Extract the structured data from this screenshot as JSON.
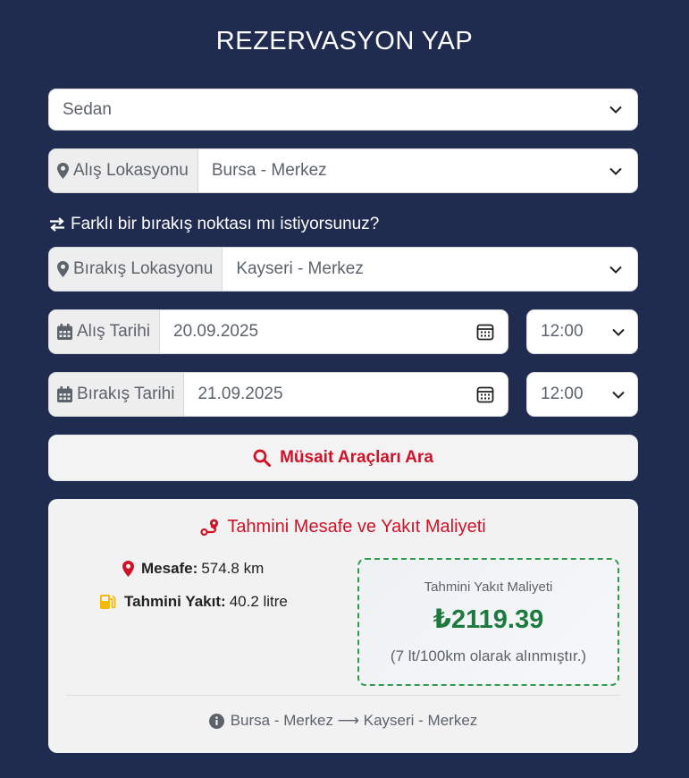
{
  "title": "REZERVASYON YAP",
  "vehicle_select": {
    "value": "Sedan"
  },
  "pickup_location": {
    "label": "Alış Lokasyonu",
    "value": "Bursa - Merkez"
  },
  "dropoff_hint": "Farklı bir bırakış noktası mı istiyorsunuz?",
  "dropoff_location": {
    "label": "Bırakış Lokasyonu",
    "value": "Kayseri - Merkez"
  },
  "pickup_date": {
    "label": "Alış Tarihi",
    "value": "20.09.2025",
    "time": "12:00"
  },
  "dropoff_date": {
    "label": "Bırakış Tarihi",
    "value": "21.09.2025",
    "time": "12:00"
  },
  "search_button": "Müsait Araçları Ara",
  "estimate": {
    "title": "Tahmini Mesafe ve Yakıt Maliyeti",
    "distance_label": "Mesafe:",
    "distance_value": "574.8 km",
    "fuel_label": "Tahmini Yakıt:",
    "fuel_value": "40.2 litre",
    "cost_label": "Tahmini Yakıt Maliyeti",
    "cost_value": "₺2119.39",
    "cost_note": "(7 lt/100km olarak alınmıştır.)",
    "route": "Bursa - Merkez ⟶ Kayseri - Merkez"
  },
  "colors": {
    "background": "#1f2b4f",
    "accent_red": "#d01228",
    "accent_green": "#1d7a3f",
    "fuel_icon": "#f2b90f"
  },
  "icons": [
    "chevron-down-icon",
    "map-pin-icon",
    "swap-arrows-icon",
    "calendar-icon",
    "calendar-picker-icon",
    "search-icon",
    "route-icon",
    "fuel-pump-icon",
    "info-icon"
  ]
}
